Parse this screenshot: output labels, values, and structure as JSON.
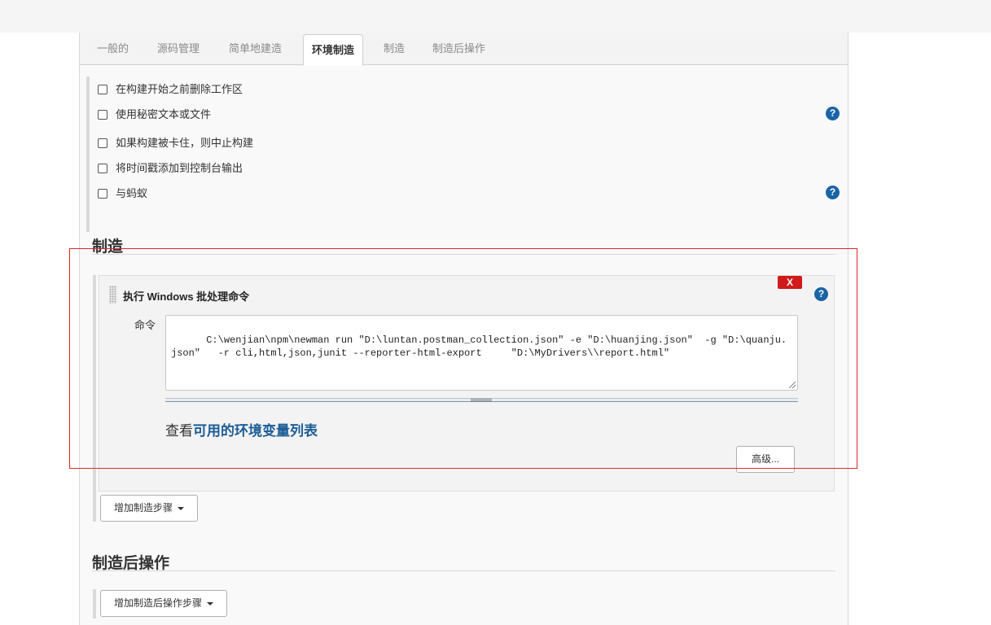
{
  "tabs": [
    {
      "label": "一般的",
      "active": false
    },
    {
      "label": "源码管理",
      "active": false
    },
    {
      "label": "简单地建造",
      "active": false
    },
    {
      "label": "环境制造",
      "active": true
    },
    {
      "label": "制造",
      "active": false
    },
    {
      "label": "制造后操作",
      "active": false
    }
  ],
  "build_env": {
    "options": [
      {
        "label": "在构建开始之前删除工作区",
        "checked": false
      },
      {
        "label": "使用秘密文本或文件",
        "checked": false
      },
      {
        "label": "如果构建被卡住，则中止构建",
        "checked": false
      },
      {
        "label": "将时间戳添加到控制台输出",
        "checked": false
      },
      {
        "label": "与蚂蚁",
        "checked": false
      }
    ],
    "help_icon": "?"
  },
  "build": {
    "title": "制造",
    "step": {
      "title": "执行 Windows 批处理命令",
      "delete_label": "X",
      "command_label": "命令",
      "command_value": "C:\\wenjian\\npm\\newman run \"D:\\luntan.postman_collection.json\" -e \"D:\\huanjing.json\"  -g \"D:\\quanju.json\"   -r cli,html,json,junit --reporter-html-export     \"D:\\MyDrivers\\\\report.html\"",
      "env_prefix": "查看",
      "env_link": "可用的环境变量列表",
      "advanced_label": "高级..."
    },
    "add_step_label": "增加制造步骤"
  },
  "post_build": {
    "title": "制造后操作",
    "add_step_label": "增加制造后操作步骤"
  },
  "colors": {
    "help_blue": "#1a64a6",
    "link_blue": "#1c5d95",
    "delete_red": "#d11a1a",
    "highlight_frame": "#e0282a"
  }
}
